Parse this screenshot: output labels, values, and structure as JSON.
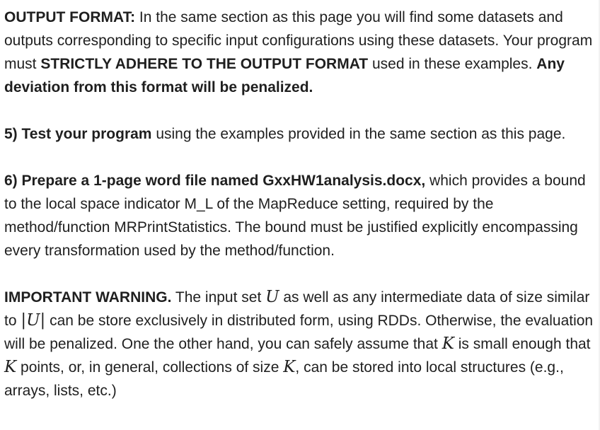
{
  "p1": {
    "lead": "OUTPUT FORMAT:",
    "t1": " In the same section as this page you will find some datasets and outputs corresponding to specific input configurations using these datasets. Your program must ",
    "strong": "STRICTLY ADHERE TO THE OUTPUT FORMAT",
    "t2": " used in these examples. ",
    "tail": "Any deviation from this format will be penalized."
  },
  "p2": {
    "lead": "5) Test your program",
    "t1": " using the examples provided in the same section as this page."
  },
  "p3": {
    "lead": "6) Prepare a 1-page word file named GxxHW1analysis.docx,",
    "t1": " which provides a bound to the local space indicator M_L of the MapReduce setting, required by the method/function MRPrintStatistics. The bound must be justified explicitly encompassing every transformation used by the method/function."
  },
  "p4": {
    "lead": "IMPORTANT WARNING.",
    "t1": " The input set ",
    "m1": "U",
    "t2": " as well as any intermediate data of size similar to ",
    "m2": "|U|",
    "t3": " can be store exclusively in distributed form, using RDDs. Otherwise, the evaluation will be penalized. One the other hand, you can safely assume that ",
    "m3": "K",
    "t4": " is small enough that ",
    "m4": "K",
    "t5": " points, or, in general, collections of size ",
    "m5": "K",
    "t6": ", can be stored into local structures (e.g., arrays, lists, etc.)"
  }
}
